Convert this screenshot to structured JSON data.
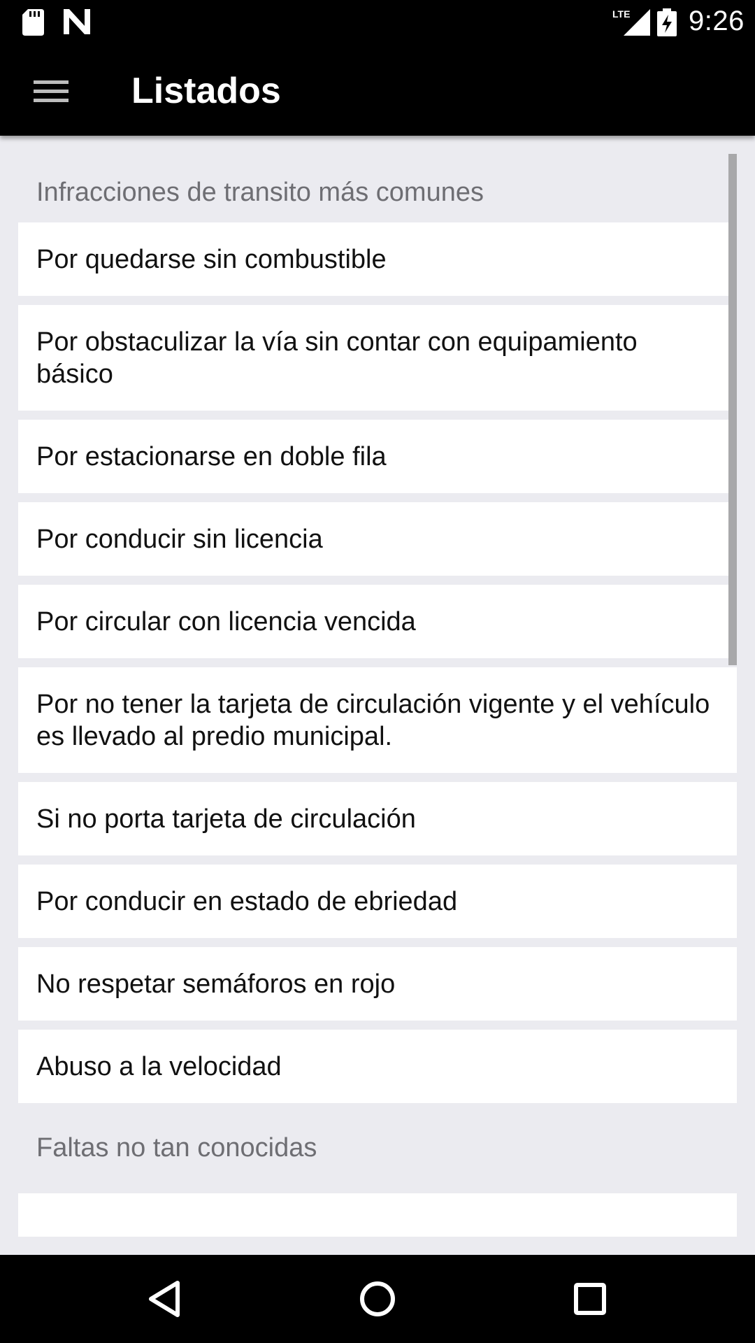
{
  "status_bar": {
    "time": "9:26",
    "icons": [
      "sd-card-icon",
      "n-notification-icon",
      "lte-signal-icon",
      "battery-charging-icon"
    ],
    "network_label": "LTE"
  },
  "app_bar": {
    "title": "Listados",
    "menu_icon": "hamburger-menu-icon"
  },
  "sections": [
    {
      "header": "Infracciones de transito más comunes",
      "items": [
        "Por quedarse sin combustible",
        "Por obstaculizar la vía sin contar con equipamiento básico",
        "Por estacionarse en doble fila",
        "Por conducir sin licencia",
        "Por circular con licencia vencida",
        "Por no tener la tarjeta de circulación vigente y el vehículo es llevado al predio municipal.",
        "Si no porta tarjeta de circulación",
        "Por conducir en estado de ebriedad",
        "No respetar semáforos en rojo",
        "Abuso a la velocidad"
      ]
    },
    {
      "header": "Faltas no tan conocidas",
      "items": [
        ""
      ]
    }
  ],
  "nav_bar": {
    "icons": [
      "back-icon",
      "home-icon",
      "recent-apps-icon"
    ]
  },
  "colors": {
    "background": "#ebebf0",
    "app_bar": "#000000",
    "item_background": "#ffffff",
    "header_text": "#6e6e73"
  }
}
